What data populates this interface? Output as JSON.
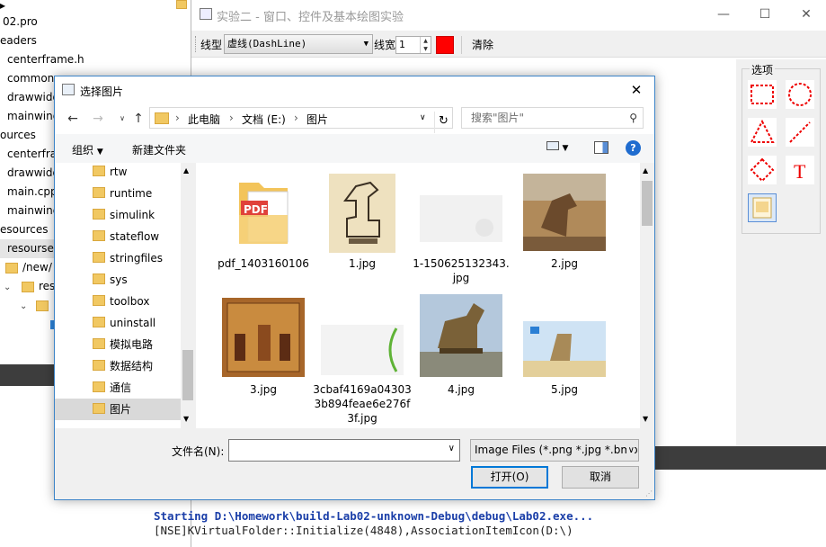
{
  "tree": {
    "items": [
      {
        "label": "02.pro",
        "kind": "file"
      },
      {
        "label": "eaders",
        "kind": "group"
      },
      {
        "label": "centerframe.h",
        "kind": "file"
      },
      {
        "label": "common",
        "kind": "file"
      },
      {
        "label": "drawwidg",
        "kind": "file"
      },
      {
        "label": "mainwind",
        "kind": "file"
      },
      {
        "label": "ources",
        "kind": "group"
      },
      {
        "label": "centerfra",
        "kind": "file"
      },
      {
        "label": "drawwidg",
        "kind": "file"
      },
      {
        "label": "main.cpp",
        "kind": "file"
      },
      {
        "label": "mainwind",
        "kind": "file"
      },
      {
        "label": "esources",
        "kind": "group"
      },
      {
        "label": "resourse",
        "kind": "file"
      },
      {
        "label": "/new/",
        "kind": "folder"
      },
      {
        "label": "res",
        "kind": "folder"
      },
      {
        "label": "",
        "kind": "folder"
      }
    ]
  },
  "main_window": {
    "title": "实验二 - 窗口、控件及基本绘图实验",
    "toolbar": {
      "line_style_label": "线型",
      "line_style_value": "虚线(DashLine)",
      "line_width_label": "线宽",
      "line_width_value": "1",
      "pen_color": "#ff0000",
      "clear_label": "清除"
    },
    "options": {
      "group_label": "选项",
      "tools": [
        "rectangle-icon",
        "ellipse-icon",
        "triangle-icon",
        "line-icon",
        "diamond-icon",
        "text-icon",
        "image-icon"
      ]
    },
    "console": {
      "line1": "Starting D:\\Homework\\build-Lab02-unknown-Debug\\debug\\Lab02.exe...",
      "line2": "[NSE]KVirtualFolder::Initialize(4848),AssociationItemIcon(D:\\)"
    }
  },
  "dialog": {
    "title": "选择图片",
    "breadcrumb": [
      "此电脑",
      "文档 (E:)",
      "图片"
    ],
    "search_placeholder": "搜索\"图片\"",
    "organize_label": "组织",
    "new_folder_label": "新建文件夹",
    "nav_items": [
      "rtw",
      "runtime",
      "simulink",
      "stateflow",
      "stringfiles",
      "sys",
      "toolbox",
      "uninstall",
      "模拟电路",
      "数据结构",
      "通信",
      "图片"
    ],
    "selected_nav": "图片",
    "files": [
      {
        "name": "pdf_1403160106",
        "type": "pdf"
      },
      {
        "name": "1.jpg",
        "type": "image"
      },
      {
        "name": "1-150625132343.jpg",
        "type": "image"
      },
      {
        "name": "2.jpg",
        "type": "image"
      },
      {
        "name": "3.jpg",
        "type": "image"
      },
      {
        "name": "3cbaf4169a043033b894feae6e276f3f.jpg",
        "type": "image"
      },
      {
        "name": "4.jpg",
        "type": "image"
      },
      {
        "name": "5.jpg",
        "type": "image"
      }
    ],
    "filename_label": "文件名(N):",
    "filename_value": "",
    "filter_value": "Image Files (*.png *.jpg *.bmp)",
    "open_label": "打开(O)",
    "cancel_label": "取消"
  }
}
